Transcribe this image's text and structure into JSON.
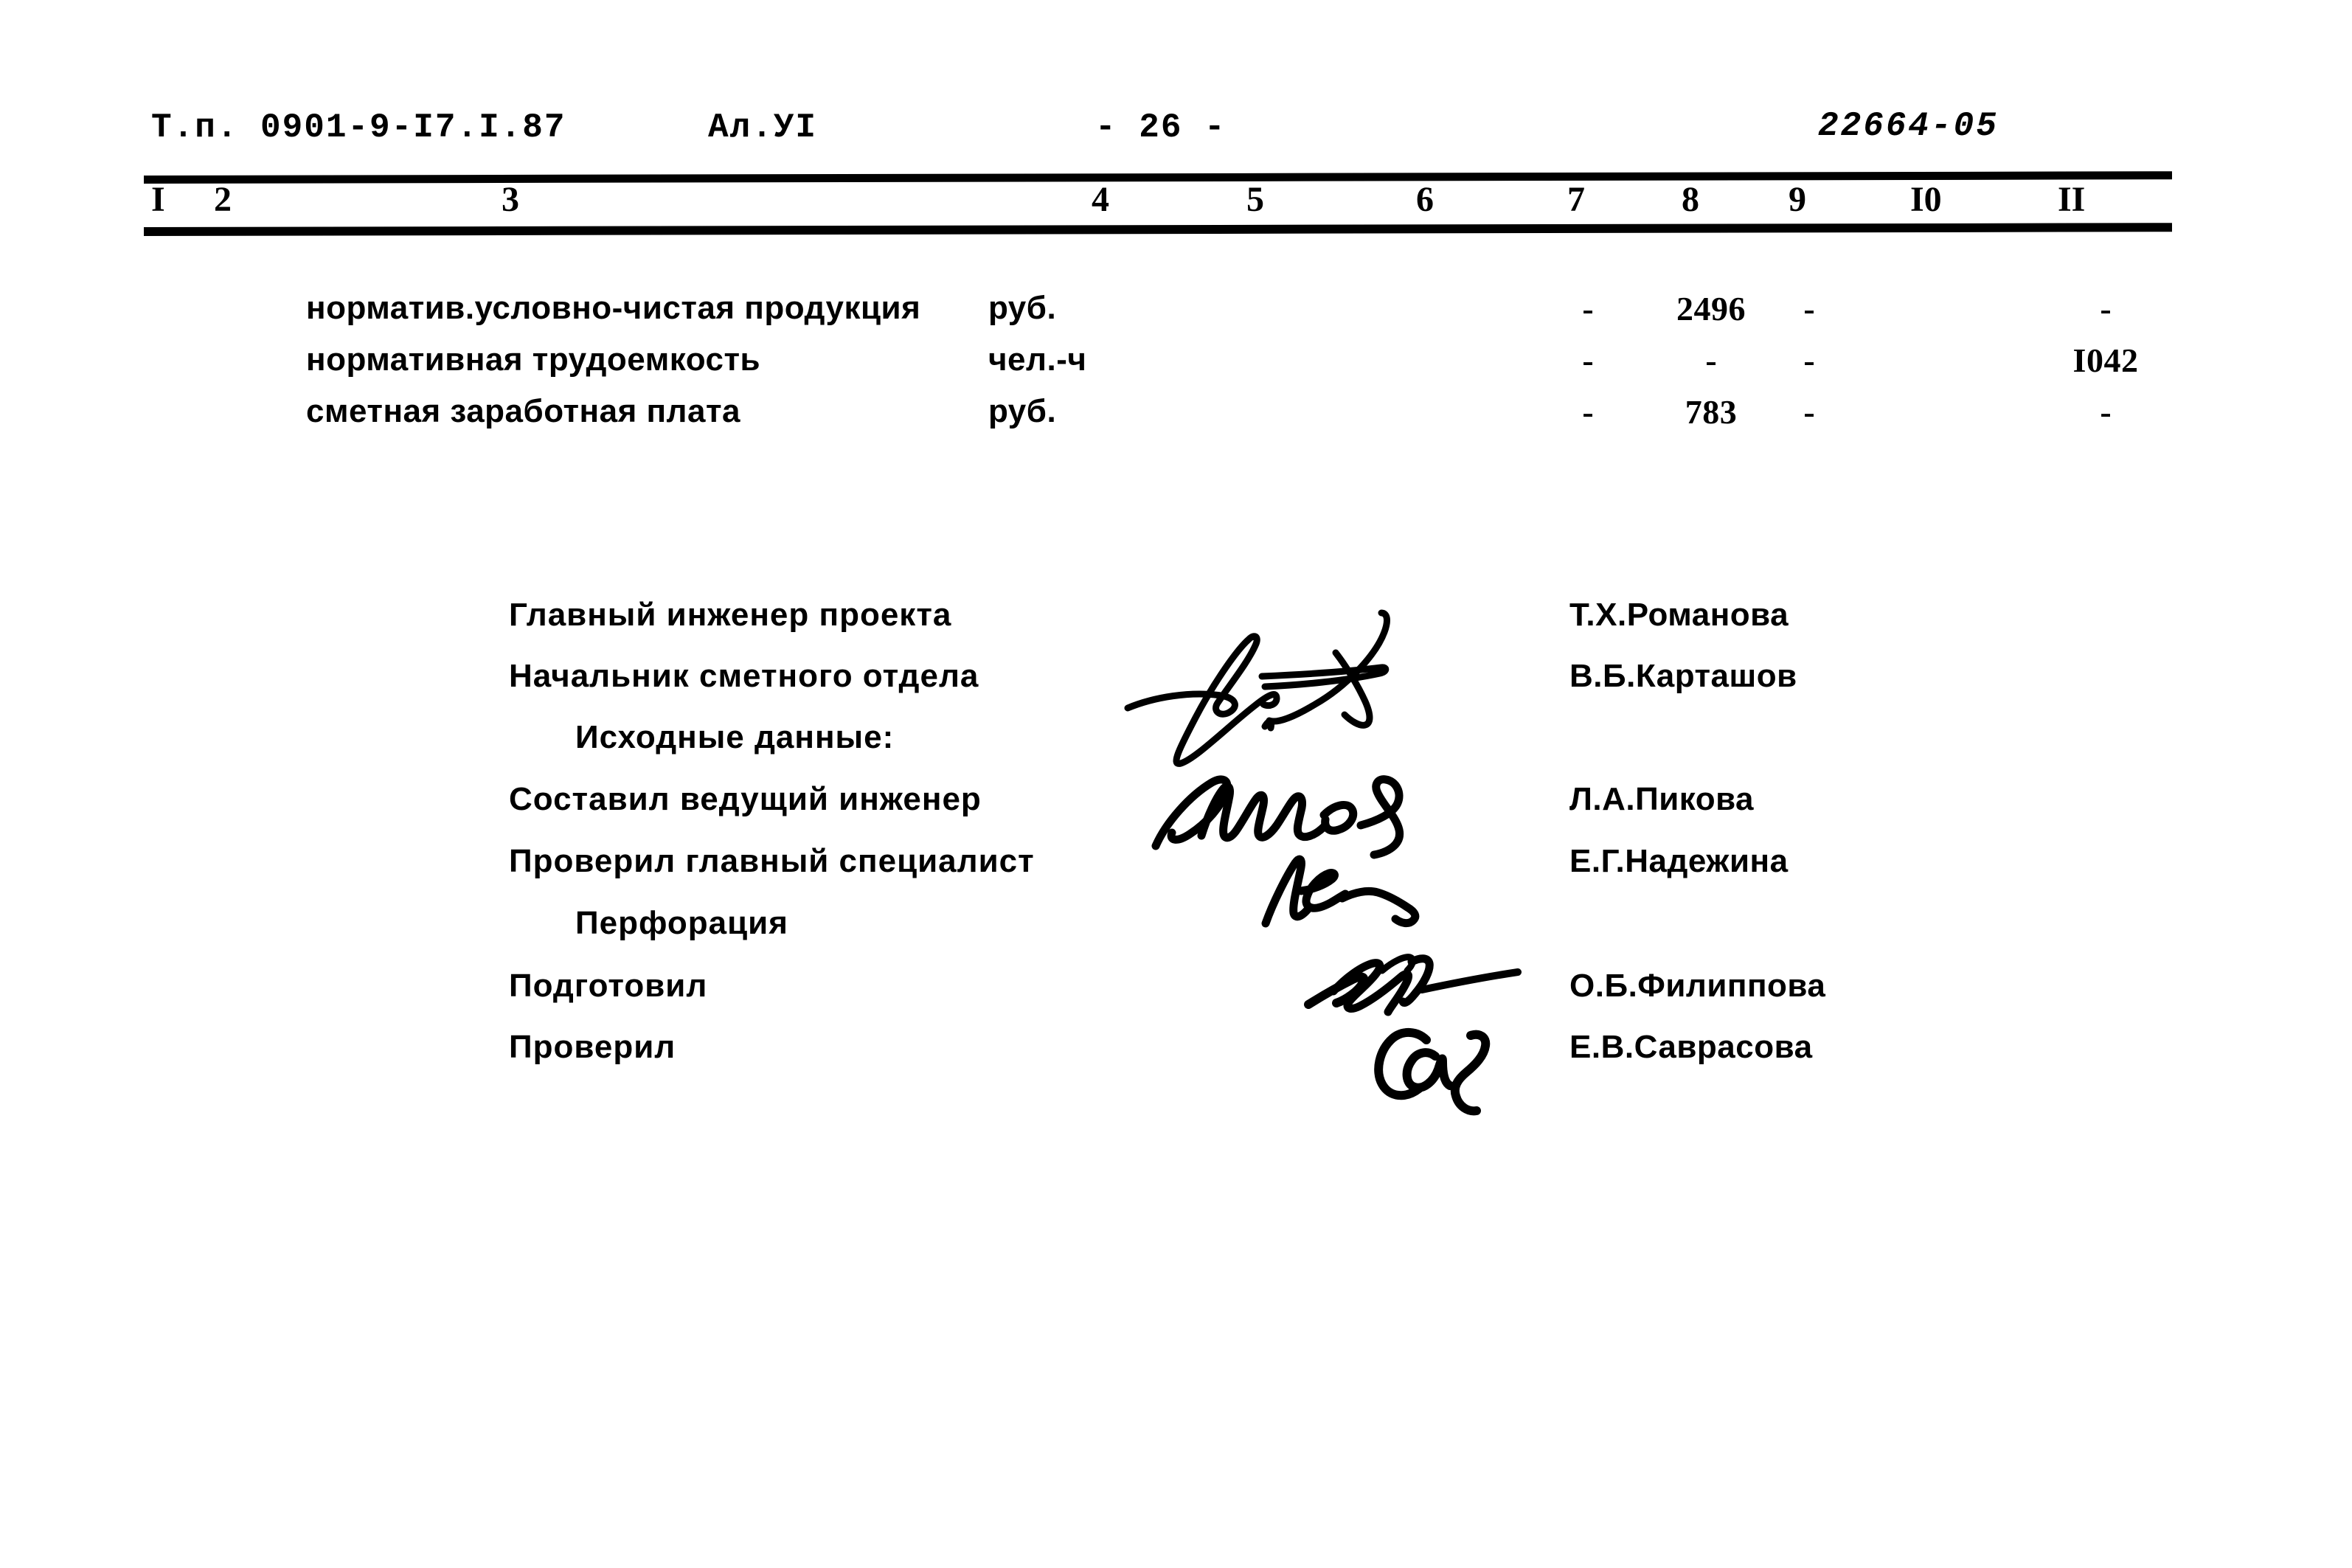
{
  "header": {
    "type_prefix": "Т.п. 0901-9-I7.I.87",
    "album": "Ал.УI",
    "page": "- 26 -",
    "doc_number": "22664-05"
  },
  "table": {
    "column_numbers": [
      "I",
      "2",
      "3",
      "4",
      "5",
      "6",
      "7",
      "8",
      "9",
      "I0",
      "II"
    ],
    "rows": [
      {
        "label": "норматив.условно-чистая продукция",
        "unit": "руб.",
        "c7": "-",
        "c8": "2496",
        "c9": "-",
        "c11": "-"
      },
      {
        "label": "нормативная трудоемкость",
        "unit": "чел.-ч",
        "c7": "-",
        "c8": "-",
        "c9": "-",
        "c11": "I042"
      },
      {
        "label": "сметная заработная плата",
        "unit": "руб.",
        "c7": "-",
        "c8": "783",
        "c9": "-",
        "c11": "-"
      }
    ]
  },
  "signatures": {
    "entries": [
      {
        "role": "Главный инженер проекта",
        "name": "Т.Х.Романова"
      },
      {
        "role": "Начальник сметного отдела",
        "name": "В.Б.Карташов"
      },
      {
        "role": "Исходные данные:",
        "name": ""
      },
      {
        "role": "Составил ведущий инженер",
        "name": "Л.А.Пикова"
      },
      {
        "role": "Проверил главный специалист",
        "name": "Е.Г.Надежина"
      },
      {
        "role": "Перфорация",
        "name": ""
      },
      {
        "role": "Подготовил",
        "name": "О.Б.Филиппова"
      },
      {
        "role": "Проверил",
        "name": "Е.В.Саврасова"
      }
    ]
  },
  "colors": {
    "ink": "#000000",
    "paper": "#ffffff"
  }
}
